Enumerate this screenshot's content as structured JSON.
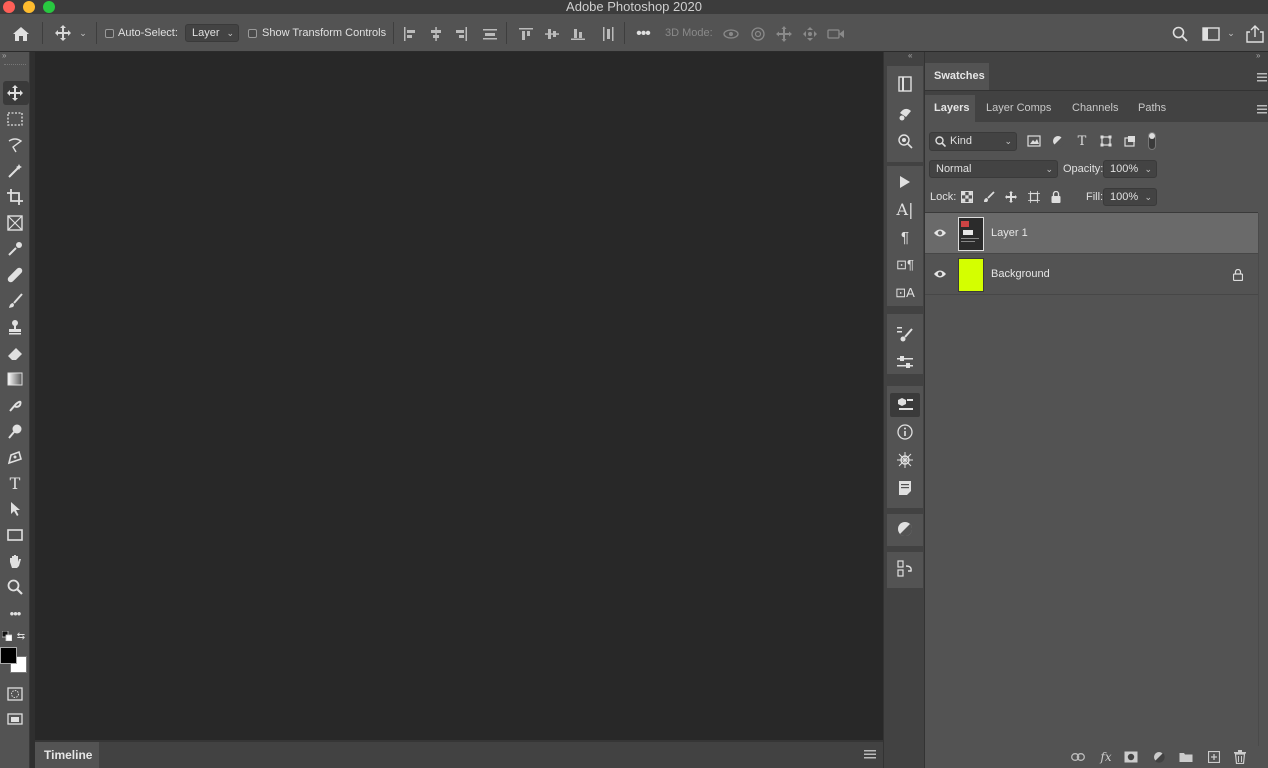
{
  "app": {
    "title": "Adobe Photoshop 2020"
  },
  "colors": {
    "accent_background_layer": "#d4ff00",
    "panel_bg": "#535353",
    "canvas_bg": "#282828"
  },
  "options_bar": {
    "auto_select_label": "Auto-Select:",
    "auto_select_target": "Layer",
    "show_transform_label": "Show Transform Controls",
    "mode_3d_label": "3D Mode:"
  },
  "tools": [
    "move-tool-icon",
    "marquee-tool-icon",
    "lasso-tool-icon",
    "magic-wand-tool-icon",
    "crop-tool-icon",
    "frame-tool-icon",
    "eyedropper-tool-icon",
    "healing-brush-tool-icon",
    "brush-tool-icon",
    "clone-stamp-tool-icon",
    "eraser-tool-icon",
    "gradient-tool-icon",
    "smudge-tool-icon",
    "dodge-tool-icon",
    "pen-tool-icon",
    "type-tool-icon",
    "path-selection-tool-icon",
    "rectangle-tool-icon",
    "hand-tool-icon",
    "zoom-tool-icon",
    "more-tools-icon"
  ],
  "swatches_panel": {
    "tab": "Swatches"
  },
  "layers_panel": {
    "tabs": [
      "Layers",
      "Layer Comps",
      "Channels",
      "Paths"
    ],
    "active_tab": "Layers",
    "filter_kind": "Kind",
    "blend_mode": "Normal",
    "opacity_label": "Opacity:",
    "opacity_value": "100%",
    "lock_label": "Lock:",
    "fill_label": "Fill:",
    "fill_value": "100%",
    "layers": [
      {
        "name": "Layer 1",
        "visible": true,
        "selected": true,
        "locked": false
      },
      {
        "name": "Background",
        "visible": true,
        "selected": false,
        "locked": true
      }
    ]
  },
  "timeline": {
    "tab": "Timeline"
  }
}
